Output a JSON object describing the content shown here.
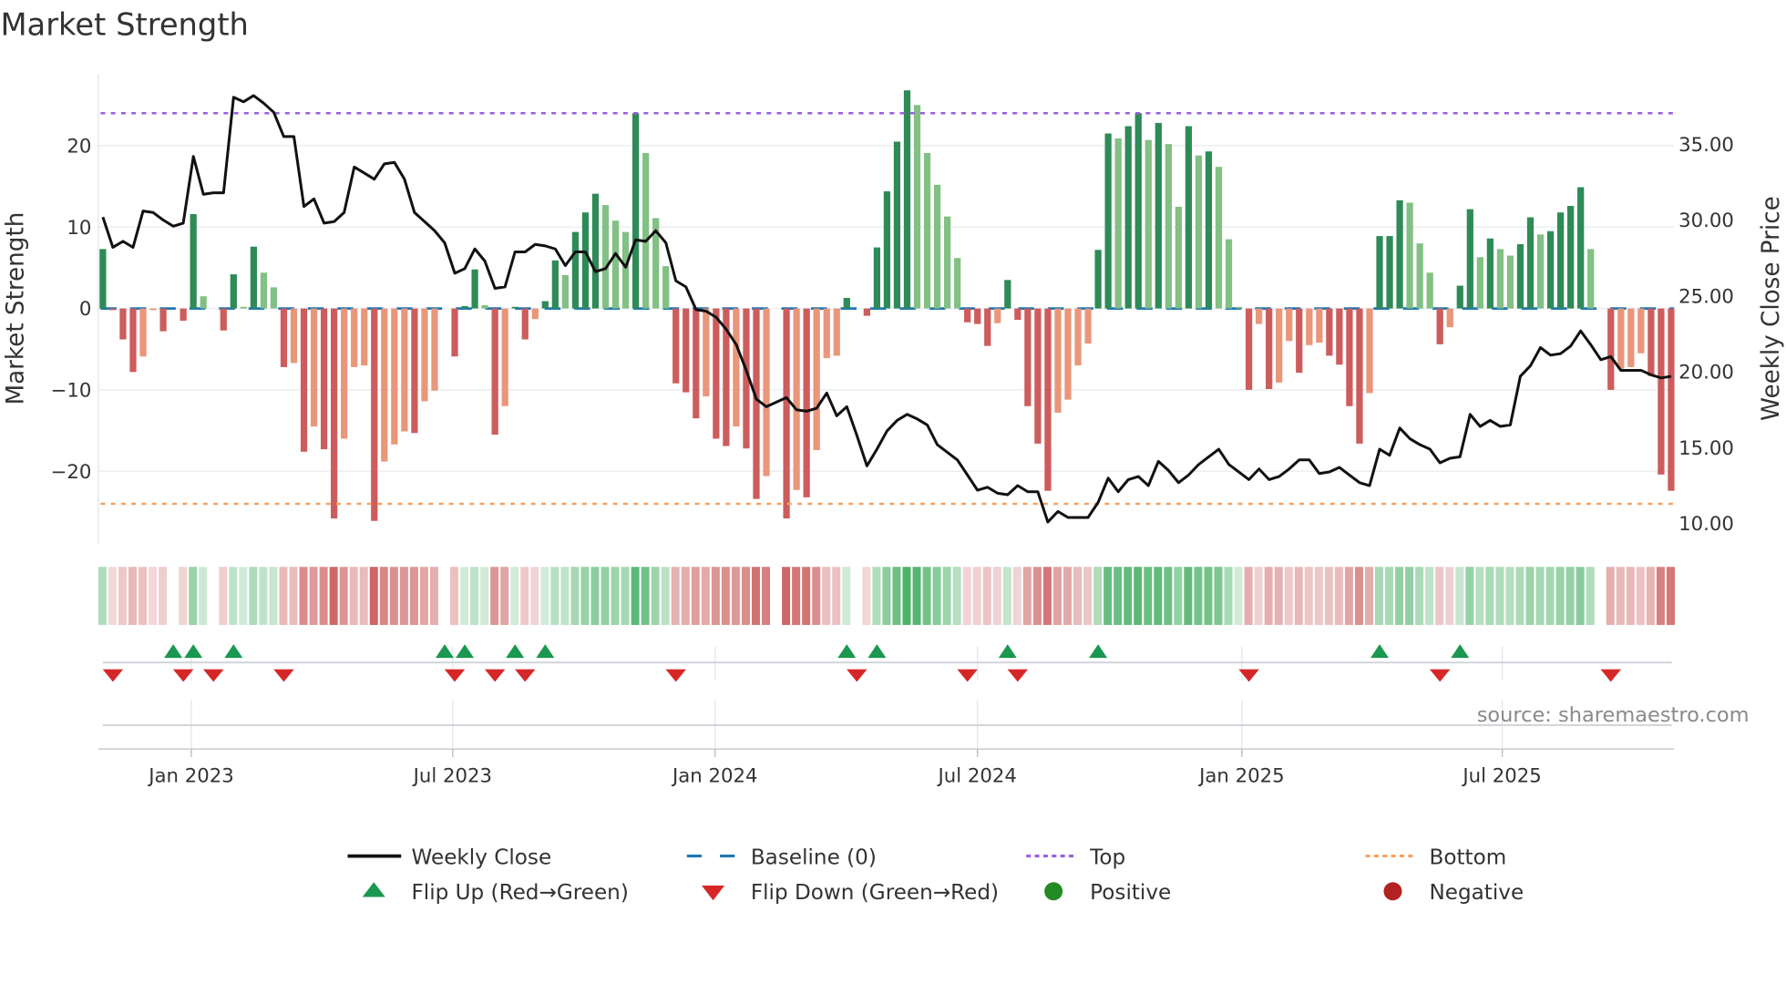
{
  "chart_data": {
    "type": "bar",
    "title": "Market Strength",
    "ylabel": "Market Strength",
    "y2label": "Weekly Close Price",
    "ylim": [
      -28.5,
      28.5
    ],
    "y2lim": [
      9.0,
      40.0
    ],
    "x_unit": "week index",
    "y_ticks": [
      20,
      10,
      0,
      -10,
      -20
    ],
    "y_tick_labels": [
      "20",
      "10",
      "0",
      "−10",
      "−20"
    ],
    "y2_ticks": [
      35,
      30,
      25,
      20,
      15,
      10
    ],
    "y2_tick_labels": [
      "35.00",
      "30.00",
      "25.00",
      "20.00",
      "15.00",
      "10.00"
    ],
    "x_ticks": [
      8.8,
      34.8,
      60.9,
      87.0,
      113.3,
      139.2
    ],
    "x_tick_labels": [
      "Jan 2023",
      "Jul 2023",
      "Jan 2024",
      "Jul 2024",
      "Jan 2025",
      "Jul 2025"
    ],
    "top_level": 24,
    "bottom_level": -24,
    "baseline": 0,
    "grid": true,
    "strength": [
      7.3,
      -0.2,
      -3.8,
      -7.8,
      -5.9,
      -0.2,
      -2.8,
      0,
      -1.5,
      11.6,
      1.5,
      0,
      -2.7,
      4.2,
      0.2,
      7.6,
      4.4,
      2.6,
      -7.2,
      -6.7,
      -17.6,
      -14.5,
      -17.3,
      -25.8,
      -16,
      -7.2,
      -7,
      -26.1,
      -18.8,
      -16.7,
      -15.1,
      -15.3,
      -11.4,
      -10.1,
      0,
      -5.9,
      0.3,
      4.8,
      0.4,
      -15.5,
      -12,
      0.2,
      -3.8,
      -1.3,
      0.9,
      5.9,
      4.1,
      9.4,
      11.8,
      14.1,
      12.7,
      10.8,
      9.4,
      24,
      19.1,
      11.1,
      5.2,
      -9.2,
      -10.3,
      -13.5,
      -10.8,
      -16,
      -16.9,
      -14.5,
      -17.2,
      -23.4,
      -20.6,
      0,
      -25.8,
      -22.3,
      -23.2,
      -17.4,
      -6.1,
      -5.8,
      1.3,
      0,
      -0.9,
      7.5,
      14.4,
      20.5,
      26.8,
      25,
      19.1,
      15.2,
      11.3,
      6.2,
      -1.7,
      -1.9,
      -4.6,
      -1.8,
      3.5,
      -1.4,
      -12,
      -16.6,
      -22.4,
      -12.8,
      -11.2,
      -7,
      -4.3,
      7.2,
      21.5,
      20.9,
      22.4,
      24,
      20.7,
      22.8,
      20.2,
      12.5,
      22.4,
      18.8,
      19.3,
      17.4,
      8.5,
      0.2,
      -10,
      -1.9,
      -9.9,
      -9.1,
      -4,
      -7.9,
      -4.5,
      -4.2,
      -5.8,
      -6.9,
      -12,
      -16.6,
      -10.4,
      8.9,
      8.9,
      13.3,
      13,
      8,
      4.4,
      -4.4,
      -2.3,
      2.8,
      12.2,
      6.3,
      8.6,
      7.3,
      6.5,
      7.9,
      11.2,
      9.1,
      9.5,
      11.8,
      12.6,
      14.9,
      7.3,
      0,
      -10,
      -7.4,
      -7.2,
      -5.5,
      -8.3,
      -20.4,
      -22.4
    ],
    "weekly_close": [
      30.2,
      28.2,
      28.6,
      28.2,
      30.6,
      30.5,
      30,
      29.6,
      29.8,
      34.2,
      31.7,
      31.8,
      31.8,
      38.1,
      37.8,
      38.2,
      37.7,
      37.1,
      35.5,
      35.5,
      30.9,
      31.4,
      29.8,
      29.9,
      30.5,
      33.5,
      33.1,
      32.7,
      33.7,
      33.8,
      32.7,
      30.5,
      29.9,
      29.3,
      28.5,
      26.5,
      26.8,
      28.1,
      27.3,
      25.5,
      25.6,
      27.9,
      27.9,
      28.4,
      28.3,
      28.1,
      27,
      27.9,
      27.9,
      26.6,
      26.8,
      27.8,
      26.9,
      28.7,
      28.6,
      29.3,
      28.5,
      26,
      25.6,
      24.1,
      24,
      23.6,
      22.8,
      21.8,
      20.1,
      18.2,
      17.7,
      18,
      18.3,
      17.5,
      17.4,
      17.6,
      18.6,
      17.1,
      17.7,
      15.8,
      13.8,
      14.9,
      16.1,
      16.8,
      17.2,
      16.9,
      16.5,
      15.2,
      14.7,
      14.2,
      13.2,
      12.2,
      12.4,
      12,
      11.9,
      12.5,
      12.1,
      12.1,
      10.1,
      10.8,
      10.4,
      10.4,
      10.4,
      11.4,
      13,
      12.1,
      12.9,
      13.1,
      12.5,
      14.1,
      13.5,
      12.7,
      13.2,
      13.9,
      14.4,
      14.9,
      13.9,
      13.4,
      12.9,
      13.6,
      12.9,
      13.1,
      13.6,
      14.2,
      14.2,
      13.3,
      13.4,
      13.7,
      13.2,
      12.7,
      12.5,
      14.9,
      14.5,
      16.3,
      15.6,
      15.2,
      14.9,
      14,
      14.3,
      14.4,
      17.2,
      16.4,
      16.8,
      16.4,
      16.5,
      19.7,
      20.4,
      21.6,
      21.1,
      21.2,
      21.7,
      22.7,
      21.8,
      20.8,
      21,
      20.1,
      20.1,
      20.1,
      19.8,
      19.6,
      19.7
    ],
    "flip_up_weeks": [
      7,
      9,
      13,
      34,
      36,
      41,
      44,
      74,
      77,
      90,
      99,
      127,
      135
    ],
    "flip_down_weeks": [
      1,
      8,
      11,
      18,
      35,
      39,
      42,
      57,
      75,
      86,
      91,
      114,
      133,
      150
    ],
    "legend_placement": "bottom",
    "legend": [
      {
        "label": "Weekly Close",
        "kind": "line",
        "color": "#111111"
      },
      {
        "label": "Baseline (0)",
        "kind": "dash",
        "color": "#1f77b4"
      },
      {
        "label": "Top",
        "kind": "dot",
        "color": "#9b5de5"
      },
      {
        "label": "Bottom",
        "kind": "dot",
        "color": "#f4a261"
      },
      {
        "label": "Flip Up (Red→Green)",
        "kind": "tri-up",
        "color": "#1a9850"
      },
      {
        "label": "Flip Down (Green→Red)",
        "kind": "tri-down",
        "color": "#d62728"
      },
      {
        "label": "Positive",
        "kind": "circle",
        "color": "#228b22"
      },
      {
        "label": "Negative",
        "kind": "circle",
        "color": "#b22222"
      }
    ],
    "colors": {
      "pos_rising": "#2e8b57",
      "pos_falling": "#82c083",
      "neg_falling": "#cd5c5c",
      "neg_rising": "#e9967a"
    },
    "source": "source: sharemaestro.com"
  }
}
